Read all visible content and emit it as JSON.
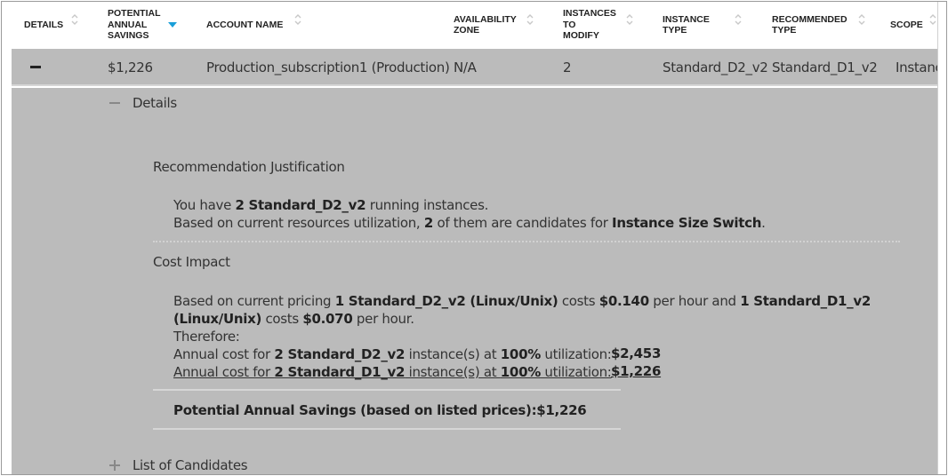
{
  "table": {
    "headers": [
      {
        "key": "details",
        "label": "DETAILS",
        "sort": "none"
      },
      {
        "key": "potential_annual_savings",
        "label": "POTENTIAL ANNUAL SAVINGS",
        "sort": "descending"
      },
      {
        "key": "account_name",
        "label": "ACCOUNT NAME",
        "sort": "none"
      },
      {
        "key": "availability_zone",
        "label": "AVAILABILITY ZONE",
        "sort": "none"
      },
      {
        "key": "instances_to_modify",
        "label": "INSTANCES TO MODIFY",
        "sort": "none"
      },
      {
        "key": "instance_type",
        "label": "INSTANCE TYPE",
        "sort": "none"
      },
      {
        "key": "recommended_type",
        "label": "RECOMMENDED TYPE",
        "sort": "none"
      },
      {
        "key": "scope",
        "label": "SCOPE",
        "sort": "none"
      }
    ],
    "header_lines": {
      "details": [
        "DETAILS"
      ],
      "potential_annual_savings": [
        "POTENTIAL",
        "ANNUAL",
        "SAVINGS"
      ],
      "account_name": [
        "ACCOUNT NAME"
      ],
      "availability_zone": [
        "AVAILABILITY",
        "ZONE"
      ],
      "instances_to_modify": [
        "INSTANCES",
        "TO",
        "MODIFY"
      ],
      "instance_type": [
        "INSTANCE",
        "TYPE"
      ],
      "recommended_type": [
        "RECOMMENDED",
        "TYPE"
      ],
      "scope": [
        "SCOPE"
      ]
    },
    "rows": [
      {
        "expanded": true,
        "potential_annual_savings": "$1,226",
        "account_name": "Production_subscription1 (Production)",
        "availability_zone": "N/A",
        "instances_to_modify": "2",
        "instance_type": "Standard_D2_v2",
        "recommended_type": "Standard_D1_v2",
        "scope": "Instanc"
      }
    ]
  },
  "detail": {
    "details_toggle": {
      "label": "Details",
      "state": "expanded"
    },
    "justification": {
      "title": "Recommendation Justification",
      "line1": {
        "pre": "You have ",
        "b1": "2 Standard_D2_v2",
        "post": " running instances."
      },
      "line2": {
        "pre": "Based on current resources utilization, ",
        "b1": "2",
        "mid": " of them are candidates for ",
        "b2": "Instance Size Switch",
        "post": "."
      }
    },
    "cost_impact": {
      "title": "Cost Impact",
      "pricing_line1": {
        "t1": "Based on current pricing ",
        "b1": "1 Standard_D2_v2 (Linux/Unix)",
        "t2": " costs ",
        "b2": "$0.140",
        "t3": " per hour and ",
        "b3": "1 Standard_D1_v2"
      },
      "pricing_line2": {
        "b1": "(Linux/Unix)",
        "t1": " costs ",
        "b2": "$0.070",
        "t2": " per hour."
      },
      "therefore": "Therefore:",
      "annual_current": {
        "t1": "Annual cost for ",
        "b1": "2 Standard_D2_v2",
        "t2": " instance(s) at ",
        "b2": "100%",
        "t3": " utilization:",
        "amount": "$2,453"
      },
      "annual_recommended": {
        "t1": "Annual cost for ",
        "b1": "2 Standard_D1_v2",
        "t2": " instance(s) at ",
        "b2": "100%",
        "t3": " utilization:",
        "amount": "$1,226"
      },
      "potential_savings": "Potential Annual Savings (based on listed prices):$1,226"
    },
    "candidates_toggle": {
      "label": "List of Candidates",
      "state": "collapsed"
    }
  },
  "colors": {
    "row_bg": "#bbbbbb",
    "sort_active": "#1a9fd9",
    "sort_inactive": "#c8c8c8"
  }
}
